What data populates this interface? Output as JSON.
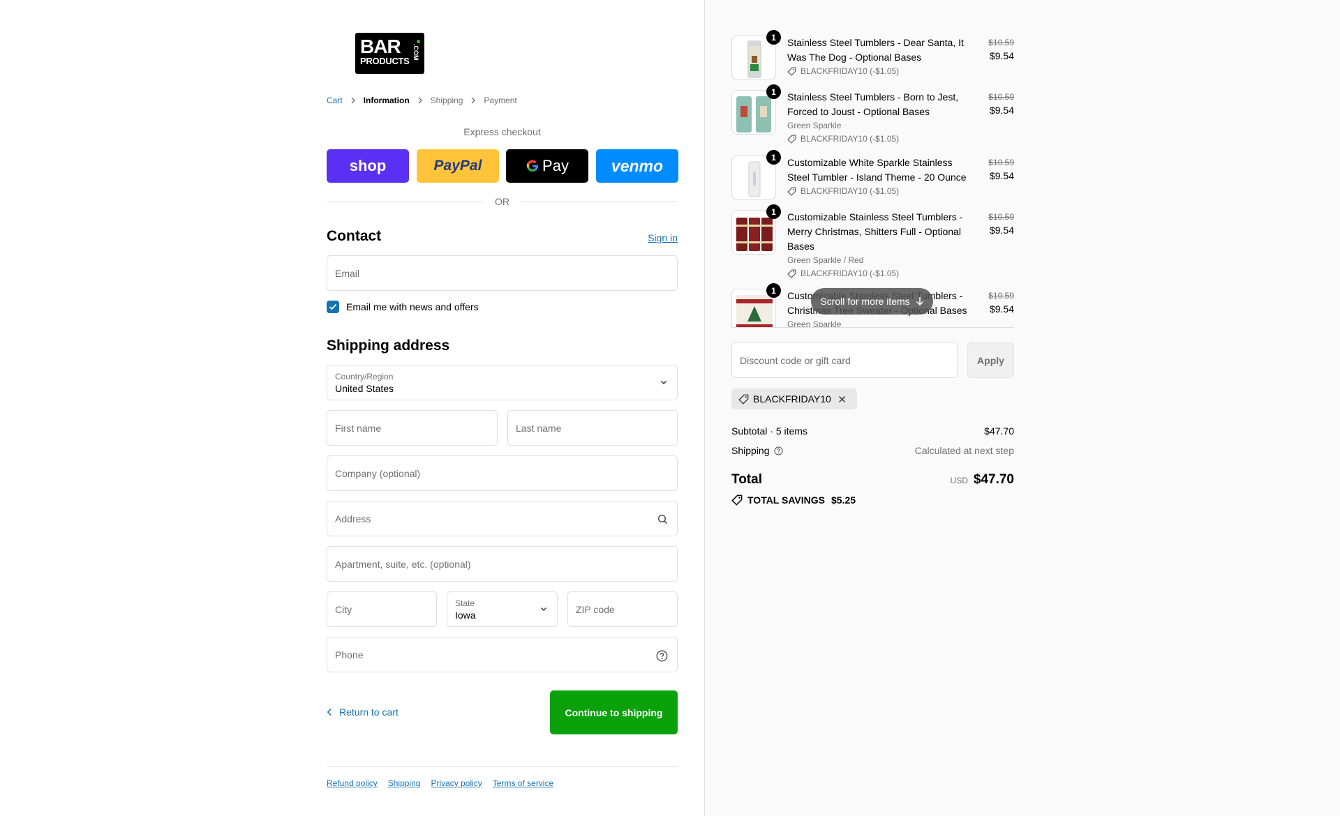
{
  "brand": {
    "logo_line1": "BAR",
    "logo_line2": "PRODUCTS",
    "logo_suffix": ".COM"
  },
  "breadcrumb": [
    "Cart",
    "Information",
    "Shipping",
    "Payment"
  ],
  "express": {
    "label": "Express checkout",
    "buttons": {
      "shop": "shop",
      "paypal": "PayPal",
      "gpay": "Pay",
      "venmo": "venmo"
    },
    "divider": "OR"
  },
  "contact": {
    "title": "Contact",
    "signin": "Sign in",
    "email_placeholder": "Email",
    "newsletter_label": "Email me with news and offers",
    "newsletter_checked": true
  },
  "shipping": {
    "title": "Shipping address",
    "country_label": "Country/Region",
    "country_value": "United States",
    "first_name": "First name",
    "last_name": "Last name",
    "company": "Company (optional)",
    "address": "Address",
    "apartment": "Apartment, suite, etc. (optional)",
    "city": "City",
    "state_label": "State",
    "state_value": "Iowa",
    "zip": "ZIP code",
    "phone": "Phone"
  },
  "actions": {
    "return": "Return to cart",
    "continue": "Continue to shipping"
  },
  "footer": [
    "Refund policy",
    "Shipping",
    "Privacy policy",
    "Terms of service"
  ],
  "summary": {
    "items": [
      {
        "qty": "1",
        "name": "Stainless Steel Tumblers - Dear Santa, It Was The Dog - Optional Bases",
        "variant": "",
        "discount": "BLACKFRIDAY10 (-$1.05)",
        "old_price": "$10.59",
        "price": "$9.54"
      },
      {
        "qty": "1",
        "name": "Stainless Steel Tumblers - Born to Jest, Forced to Joust - Optional Bases",
        "variant": "Green Sparkle",
        "discount": "BLACKFRIDAY10 (-$1.05)",
        "old_price": "$10.59",
        "price": "$9.54"
      },
      {
        "qty": "1",
        "name": "Customizable White Sparkle Stainless Steel Tumbler - Island Theme - 20 Ounce",
        "variant": "",
        "discount": "BLACKFRIDAY10 (-$1.05)",
        "old_price": "$10.59",
        "price": "$9.54"
      },
      {
        "qty": "1",
        "name": "Customizable Stainless Steel Tumblers - Merry Christmas, Shitters Full - Optional Bases",
        "variant": "Green Sparkle / Red",
        "discount": "BLACKFRIDAY10 (-$1.05)",
        "old_price": "$10.59",
        "price": "$9.54"
      },
      {
        "qty": "1",
        "name": "Customizable Stainless Steel Tumblers - Christmas Tree Sweater - Optional Bases",
        "variant": "Green Sparkle",
        "discount": "",
        "old_price": "$10.59",
        "price": "$9.54"
      }
    ],
    "scroll_hint": "Scroll for more items",
    "discount_placeholder": "Discount code or gift card",
    "apply": "Apply",
    "applied_code": "BLACKFRIDAY10",
    "subtotal_label": "Subtotal · 5 items",
    "subtotal_value": "$47.70",
    "shipping_label": "Shipping",
    "shipping_value": "Calculated at next step",
    "total_label": "Total",
    "total_currency": "USD",
    "total_value": "$47.70",
    "savings_label": "TOTAL SAVINGS",
    "savings_value": "$5.25"
  },
  "colors": {
    "accent_link": "#1773b0",
    "continue_button": "#0aa10a",
    "shop_pay": "#5a31f4",
    "paypal": "#ffc439",
    "venmo": "#008cff"
  }
}
